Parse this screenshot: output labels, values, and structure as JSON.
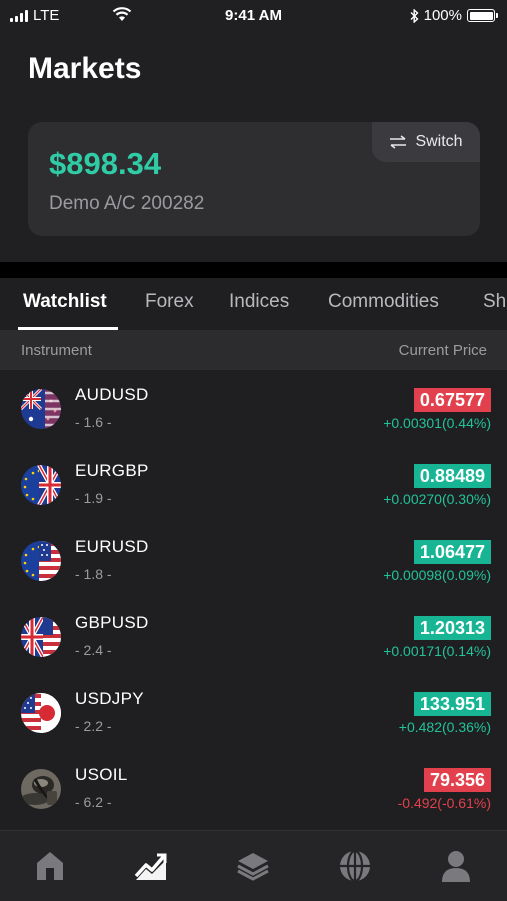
{
  "status_bar": {
    "carrier": "LTE",
    "time": "9:41 AM",
    "battery": "100%"
  },
  "header": {
    "title": "Markets"
  },
  "account_card": {
    "balance": "$898.34",
    "account": "Demo A/C 200282",
    "switch_label": "Switch"
  },
  "tabs": [
    {
      "label": "Watchlist",
      "active": true
    },
    {
      "label": "Forex"
    },
    {
      "label": "Indices"
    },
    {
      "label": "Commodities"
    },
    {
      "label": "Sh"
    }
  ],
  "columns": {
    "instrument": "Instrument",
    "current_price": "Current Price"
  },
  "instruments": [
    {
      "symbol": "AUDUSD",
      "spread": "- 1.6 -",
      "price": "0.67577",
      "change": "+0.00301(0.44%)",
      "direction": "down",
      "flag": "au-us"
    },
    {
      "symbol": "EURGBP",
      "spread": "- 1.9 -",
      "price": "0.88489",
      "change": "+0.00270(0.30%)",
      "direction": "up",
      "flag": "eu-gb"
    },
    {
      "symbol": "EURUSD",
      "spread": "- 1.8 -",
      "price": "1.06477",
      "change": "+0.00098(0.09%)",
      "direction": "up",
      "flag": "eu-us"
    },
    {
      "symbol": "GBPUSD",
      "spread": "- 2.4 -",
      "price": "1.20313",
      "change": "+0.00171(0.14%)",
      "direction": "up",
      "flag": "gb-us"
    },
    {
      "symbol": "USDJPY",
      "spread": "- 2.2 -",
      "price": "133.951",
      "change": "+0.482(0.36%)",
      "direction": "up",
      "flag": "us-jp"
    },
    {
      "symbol": "USOIL",
      "spread": "- 6.2 -",
      "price": "79.356",
      "change": "-0.492(-0.61%)",
      "direction": "down",
      "flag": "oil"
    }
  ],
  "bottom_nav": [
    {
      "icon": "home-icon"
    },
    {
      "icon": "chart-icon",
      "active": true
    },
    {
      "icon": "layers-icon"
    },
    {
      "icon": "globe-icon"
    },
    {
      "icon": "user-icon"
    }
  ],
  "colors": {
    "accent_green": "#2fcca6",
    "up": "#17b594",
    "down": "#e2404c",
    "background": "#1f1f21"
  }
}
